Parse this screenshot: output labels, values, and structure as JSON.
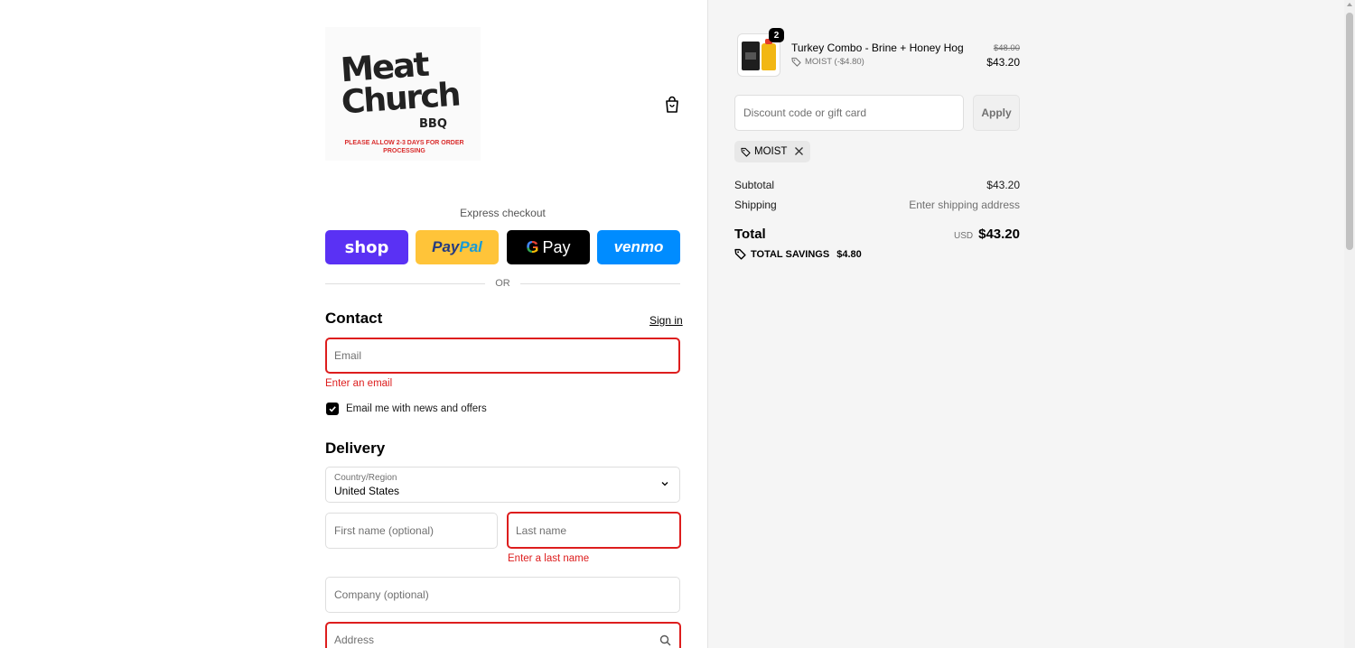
{
  "brand": {
    "logo_line1": "Meat",
    "logo_line2": "Church",
    "logo_line3": "BBQ",
    "logo_note": "PLEASE ALLOW 2-3 DAYS FOR ORDER PROCESSING"
  },
  "express": {
    "label": "Express checkout",
    "buttons": {
      "shop": "shop",
      "paypal_a": "Pay",
      "paypal_b": "Pal",
      "gpay_g": "G",
      "gpay": "Pay",
      "venmo": "venmo"
    },
    "or": "OR"
  },
  "contact": {
    "heading": "Contact",
    "sign_in": "Sign in",
    "email_placeholder": "Email",
    "email_error": "Enter an email",
    "newsletter_label": "Email me with news and offers",
    "newsletter_checked": true
  },
  "delivery": {
    "heading": "Delivery",
    "country_label": "Country/Region",
    "country_value": "United States",
    "first_name_placeholder": "First name (optional)",
    "last_name_placeholder": "Last name",
    "last_name_error": "Enter a last name",
    "company_placeholder": "Company (optional)",
    "address_placeholder": "Address"
  },
  "cart": {
    "item": {
      "name": "Turkey Combo - Brine + Honey Hog",
      "quantity": "2",
      "discount": "MOIST (-$4.80)",
      "price_original": "$48.00",
      "price": "$43.20"
    },
    "discount_placeholder": "Discount code or gift card",
    "apply_label": "Apply",
    "applied_code": "MOIST",
    "subtotal_label": "Subtotal",
    "subtotal_value": "$43.20",
    "shipping_label": "Shipping",
    "shipping_value": "Enter shipping address",
    "total_label": "Total",
    "currency": "USD",
    "total_value": "$43.20",
    "savings_label": "TOTAL SAVINGS",
    "savings_value": "$4.80"
  },
  "colors": {
    "shop": "#5a31f4",
    "paypal": "#ffc439",
    "gpay": "#000000",
    "venmo": "#008cff",
    "error": "#dd1d1d"
  },
  "icons": [
    "shopping-bag-icon",
    "chevron-down-icon",
    "search-icon",
    "tag-icon",
    "close-icon",
    "checkmark-icon"
  ]
}
